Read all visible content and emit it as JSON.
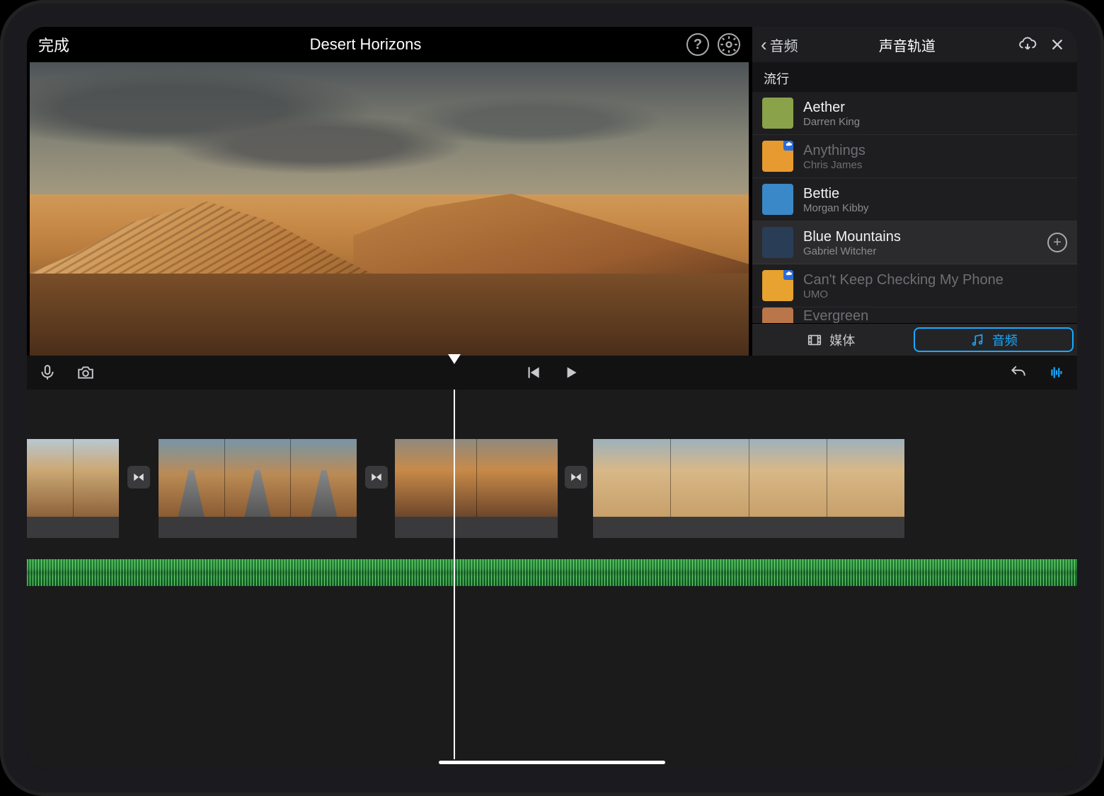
{
  "top": {
    "done": "完成",
    "title": "Desert Horizons"
  },
  "panel": {
    "back": "音频",
    "title": "声音轨道",
    "section": "流行",
    "tracks": [
      {
        "title": "Aether",
        "artist": "Darren King",
        "faded": false,
        "cloud": false,
        "thumb_color": "#8aa24a"
      },
      {
        "title": "Anythings",
        "artist": "Chris James",
        "faded": true,
        "cloud": true,
        "thumb_color": "#e79a2f"
      },
      {
        "title": "Bettie",
        "artist": "Morgan Kibby",
        "faded": false,
        "cloud": false,
        "thumb_color": "#3a88c7"
      },
      {
        "title": "Blue Mountains",
        "artist": "Gabriel Witcher",
        "faded": false,
        "cloud": false,
        "thumb_color": "#2a3d57",
        "selected": true,
        "showAdd": true
      },
      {
        "title": "Can't Keep Checking My Phone",
        "artist": "UMO",
        "faded": true,
        "cloud": true,
        "thumb_color": "#e7a22f"
      },
      {
        "title": "Evergreen",
        "artist": "",
        "faded": true,
        "cloud": false,
        "thumb_color": "#b8764a",
        "cut": true
      }
    ],
    "tabs": {
      "media": "媒体",
      "audio": "音频"
    }
  }
}
